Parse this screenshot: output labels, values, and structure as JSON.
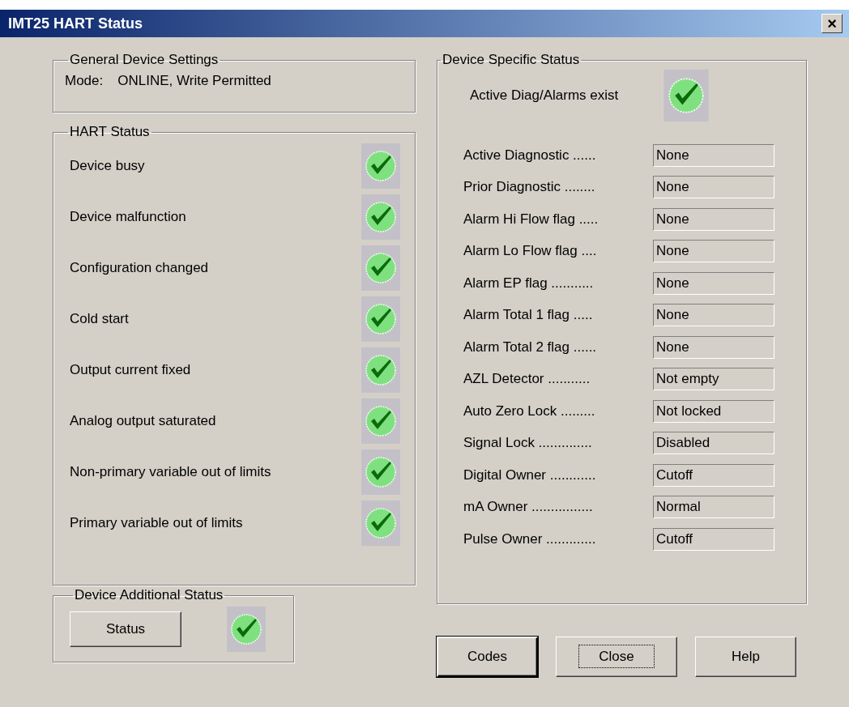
{
  "window": {
    "title": "IMT25 HART Status",
    "close": "×"
  },
  "general": {
    "title": "General Device Settings",
    "mode_label": "Mode:",
    "mode_value": "ONLINE, Write Permitted"
  },
  "hart_status": {
    "title": "HART Status",
    "items": [
      {
        "label": "Device busy"
      },
      {
        "label": "Device malfunction"
      },
      {
        "label": "Configuration changed"
      },
      {
        "label": "Cold start"
      },
      {
        "label": "Output current fixed"
      },
      {
        "label": "Analog output saturated"
      },
      {
        "label": "Non-primary variable out of limits"
      },
      {
        "label": "Primary variable out of limits"
      }
    ]
  },
  "additional": {
    "title": "Device Additional Status",
    "button": "Status"
  },
  "specific": {
    "title": "Device Specific Status",
    "alarm_label": "Active Diag/Alarms exist",
    "fields": [
      {
        "label": "Active Diagnostic ......",
        "value": "None"
      },
      {
        "label": "Prior  Diagnostic ........",
        "value": "None"
      },
      {
        "label": "Alarm Hi Flow flag .....",
        "value": "None"
      },
      {
        "label": "Alarm Lo Flow flag ....",
        "value": "None"
      },
      {
        "label": "Alarm EP flag ...........",
        "value": "None"
      },
      {
        "label": "Alarm Total 1 flag .....",
        "value": "None"
      },
      {
        "label": "Alarm Total 2 flag ......",
        "value": "None"
      },
      {
        "label": "AZL Detector ...........",
        "value": "Not empty"
      },
      {
        "label": "Auto Zero Lock .........",
        "value": "Not locked"
      },
      {
        "label": "Signal Lock ..............",
        "value": "Disabled"
      },
      {
        "label": "Digital Owner ............",
        "value": "Cutoff"
      },
      {
        "label": "mA Owner ................",
        "value": "Normal"
      },
      {
        "label": "Pulse Owner .............",
        "value": "Cutoff"
      }
    ]
  },
  "buttons": [
    {
      "label": "Codes",
      "default": true,
      "focused": false
    },
    {
      "label": "Close",
      "default": false,
      "focused": true
    },
    {
      "label": "Help",
      "default": false,
      "focused": false
    }
  ]
}
